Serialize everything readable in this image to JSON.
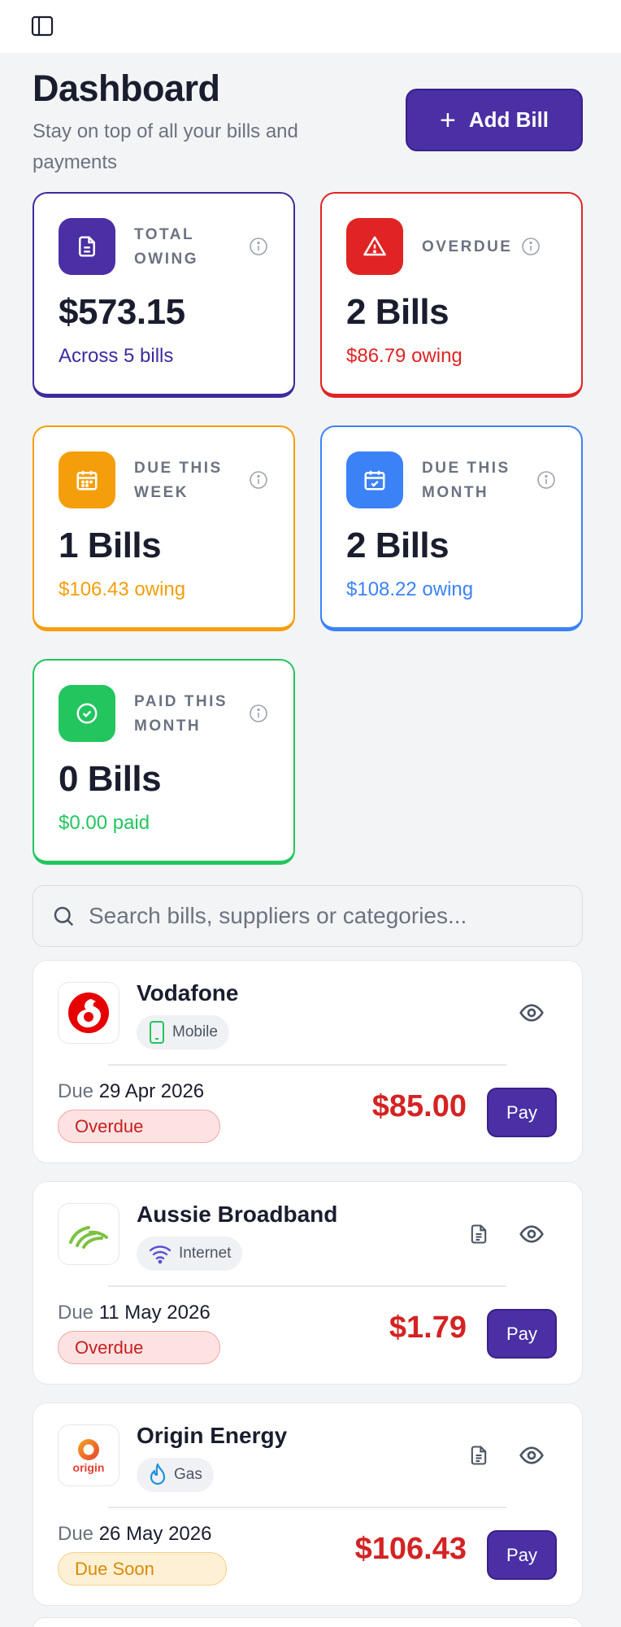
{
  "header": {
    "title": "Dashboard",
    "subtitle": "Stay on top of all your bills and payments",
    "add_label": "Add Bill"
  },
  "stats": {
    "total": {
      "label": "TOTAL OWING",
      "value": "$573.15",
      "sub": "Across 5 bills",
      "color": "#3f2aa0"
    },
    "overdue": {
      "label": "OVERDUE",
      "value": "2 Bills",
      "sub": "$86.79 owing",
      "color": "#e02424"
    },
    "week": {
      "label": "DUE THIS WEEK",
      "value": "1 Bills",
      "sub": "$106.43 owing",
      "color": "#f59e0b"
    },
    "month": {
      "label": "DUE THIS MONTH",
      "value": "2 Bills",
      "sub": "$108.22 owing",
      "color": "#3b82f6"
    },
    "paid": {
      "label": "PAID THIS MONTH",
      "value": "0 Bills",
      "sub": "$0.00 paid",
      "color": "#22c55e"
    }
  },
  "search": {
    "placeholder": "Search bills, suppliers or categories..."
  },
  "bills": [
    {
      "name": "Vodafone",
      "category": "Mobile",
      "due_prefix": "Due",
      "due_date": "29 Apr 2026",
      "status": "Overdue",
      "amount": "$85.00",
      "pay_label": "Pay"
    },
    {
      "name": "Aussie Broadband",
      "category": "Internet",
      "due_prefix": "Due",
      "due_date": "11 May 2026",
      "status": "Overdue",
      "amount": "$1.79",
      "pay_label": "Pay"
    },
    {
      "name": "Origin Energy",
      "category": "Gas",
      "due_prefix": "Due",
      "due_date": "26 May 2026",
      "status": "Due Soon",
      "amount": "$106.43",
      "pay_label": "Pay"
    }
  ],
  "logos": {
    "origin_text": "origin"
  },
  "colors": {
    "primary": "#4a2fa5",
    "danger": "#d42323",
    "warning": "#f59e0b"
  }
}
